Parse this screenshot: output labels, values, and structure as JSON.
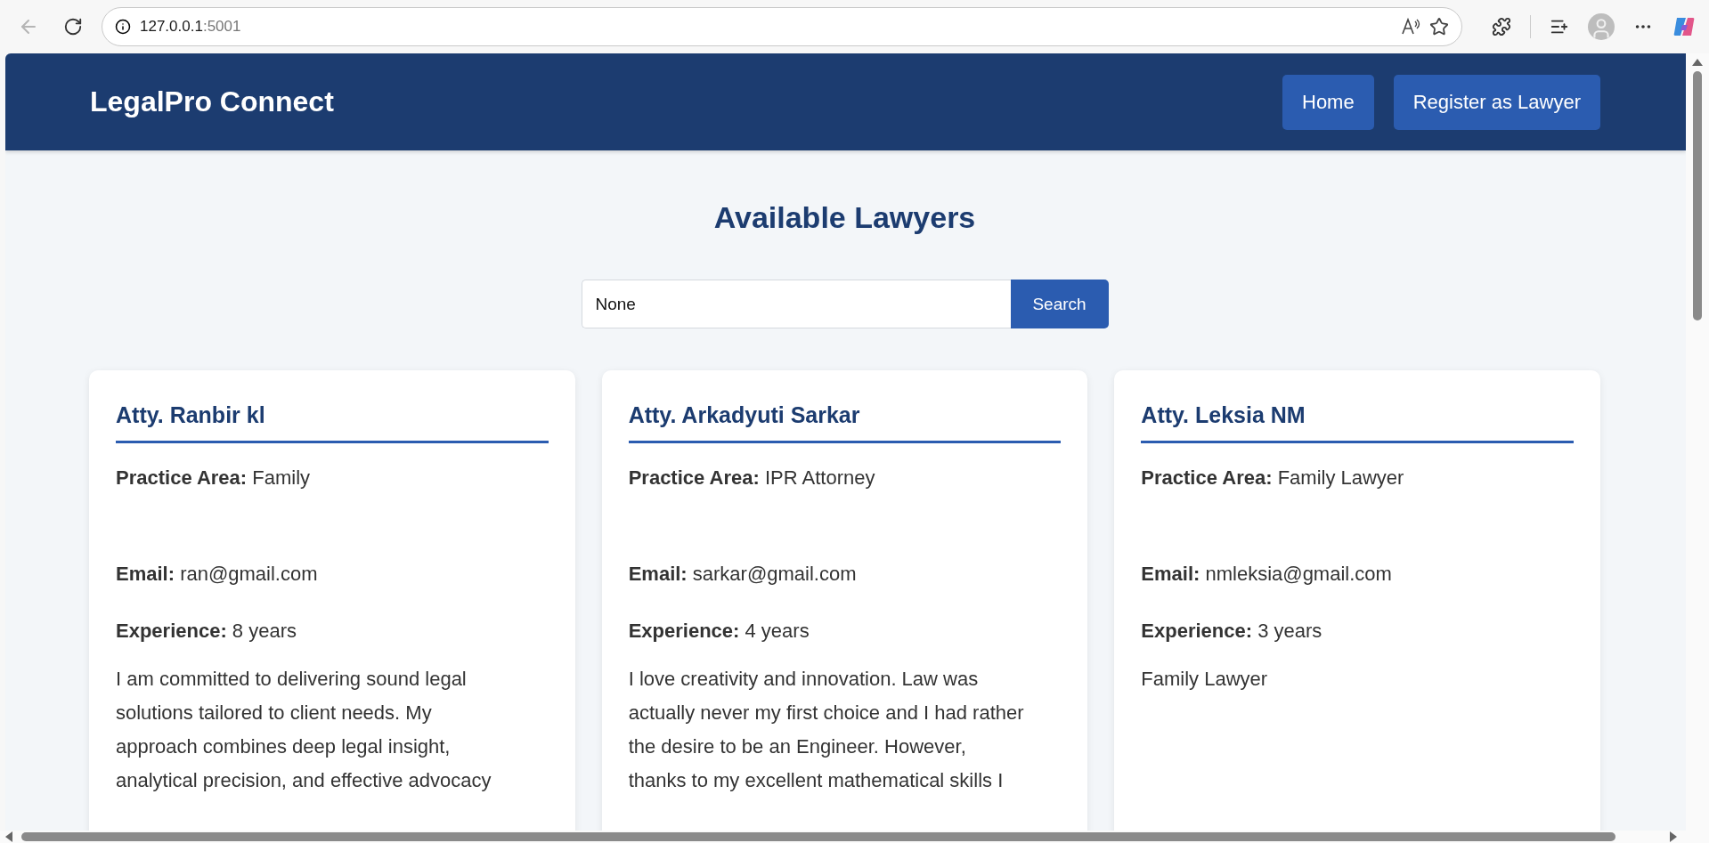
{
  "browser": {
    "address_host": "127.0.0.1",
    "address_port": ":5001"
  },
  "header": {
    "brand": "LegalPro Connect",
    "nav": [
      "Home",
      "Register as Lawyer"
    ]
  },
  "page_title": "Available Lawyers",
  "search": {
    "value": "None",
    "button": "Search"
  },
  "lawyers": [
    {
      "name": "Atty. Ranbir kl",
      "practice_label": "Practice Area:",
      "practice": "Family",
      "email_label": "Email:",
      "email": "ran@gmail.com",
      "experience_label": "Experience:",
      "experience": "8 years",
      "bio": "I am committed to delivering sound legal\nsolutions tailored to client needs. My\napproach combines deep legal insight,\nanalytical precision, and effective advocacy"
    },
    {
      "name": "Atty. Arkadyuti Sarkar",
      "practice_label": "Practice Area:",
      "practice": "IPR Attorney",
      "email_label": "Email:",
      "email": "sarkar@gmail.com",
      "experience_label": "Experience:",
      "experience": "4 years",
      "bio": "I love creativity and innovation. Law was\nactually never my first choice and I had rather\nthe desire to be an Engineer. However,\nthanks to my excellent mathematical skills I"
    },
    {
      "name": "Atty. Leksia NM",
      "practice_label": "Practice Area:",
      "practice": "Family Lawyer",
      "email_label": "Email:",
      "email": "nmleksia@gmail.com",
      "experience_label": "Experience:",
      "experience": "3 years",
      "bio": "Family Lawyer"
    }
  ]
}
